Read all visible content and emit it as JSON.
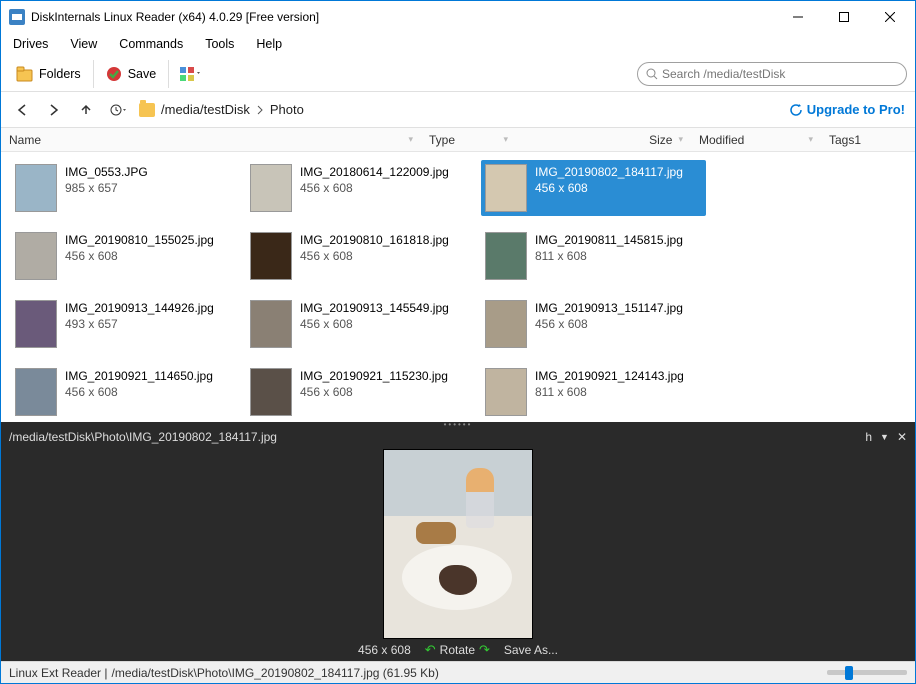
{
  "window": {
    "title": "DiskInternals Linux Reader (x64) 4.0.29 [Free version]"
  },
  "menu": {
    "drives": "Drives",
    "view": "View",
    "commands": "Commands",
    "tools": "Tools",
    "help": "Help"
  },
  "toolbar": {
    "folders": "Folders",
    "save": "Save"
  },
  "search": {
    "placeholder": "Search /media/testDisk"
  },
  "breadcrumb": {
    "seg1": "/media/testDisk",
    "seg2": "Photo"
  },
  "upgrade": "Upgrade to Pro!",
  "columns": {
    "name": "Name",
    "type": "Type",
    "size": "Size",
    "modified": "Modified",
    "tags": "Tags1"
  },
  "files": [
    {
      "name": "IMG_0553.JPG",
      "dim": "985 x 657"
    },
    {
      "name": "IMG_20180614_122009.jpg",
      "dim": "456 x 608"
    },
    {
      "name": "IMG_20190802_184117.jpg",
      "dim": "456 x 608",
      "selected": true
    },
    {
      "name": "IMG_20190810_155025.jpg",
      "dim": "456 x 608"
    },
    {
      "name": "IMG_20190810_161818.jpg",
      "dim": "456 x 608"
    },
    {
      "name": "IMG_20190811_145815.jpg",
      "dim": "811 x 608"
    },
    {
      "name": "IMG_20190913_144926.jpg",
      "dim": "493 x 657"
    },
    {
      "name": "IMG_20190913_145549.jpg",
      "dim": "456 x 608"
    },
    {
      "name": "IMG_20190913_151147.jpg",
      "dim": "456 x 608"
    },
    {
      "name": "IMG_20190921_114650.jpg",
      "dim": "456 x 608"
    },
    {
      "name": "IMG_20190921_115230.jpg",
      "dim": "456 x 608"
    },
    {
      "name": "IMG_20190921_124143.jpg",
      "dim": "811 x 608"
    }
  ],
  "preview": {
    "path": "/media/testDisk\\Photo\\IMG_20190802_184117.jpg",
    "dim": "456 x 608",
    "rotate": "Rotate",
    "saveas": "Save As...",
    "menu_h": "h"
  },
  "status": {
    "left": "Linux Ext Reader |",
    "path": "/media/testDisk\\Photo\\IMG_20190802_184117.jpg (61.95 Kb)"
  }
}
